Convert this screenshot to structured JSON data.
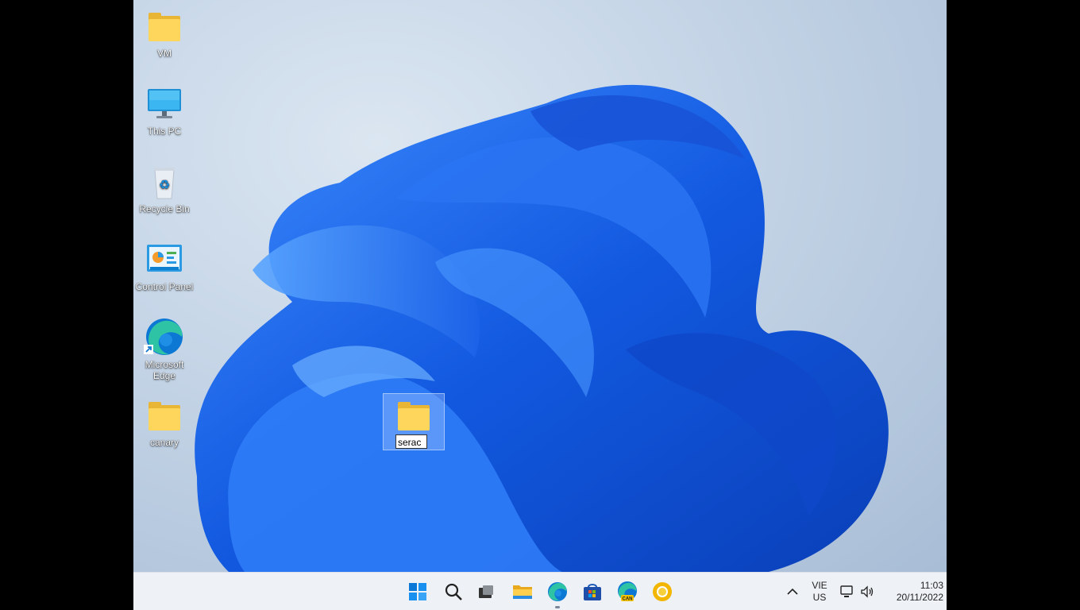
{
  "desktop": {
    "icons": [
      {
        "name": "VM",
        "type": "folder"
      },
      {
        "name": "This PC",
        "type": "monitor-icon"
      },
      {
        "name": "Recycle Bin",
        "type": "recycle-bin-icon"
      },
      {
        "name": "Control Panel",
        "type": "control-panel-icon"
      },
      {
        "name": "Microsoft Edge",
        "type": "edge-icon"
      },
      {
        "name": "canary",
        "type": "folder"
      }
    ],
    "renaming_folder": {
      "value": "serac",
      "type": "folder"
    }
  },
  "taskbar": {
    "apps": [
      "start-icon",
      "search-icon",
      "task-view-icon",
      "file-explorer-icon",
      "edge-icon",
      "store-icon",
      "edge-canary-icon",
      "chrome-canary-icon"
    ],
    "canary_badge": "CAN",
    "tray": {
      "language": "VIE",
      "layout": "US",
      "time": "11:03",
      "date": "20/11/2022"
    }
  },
  "colors": {
    "accent": "#0067c0",
    "folder": "#ffd65c",
    "wallpaper_bloom": "#1f6ff0"
  }
}
